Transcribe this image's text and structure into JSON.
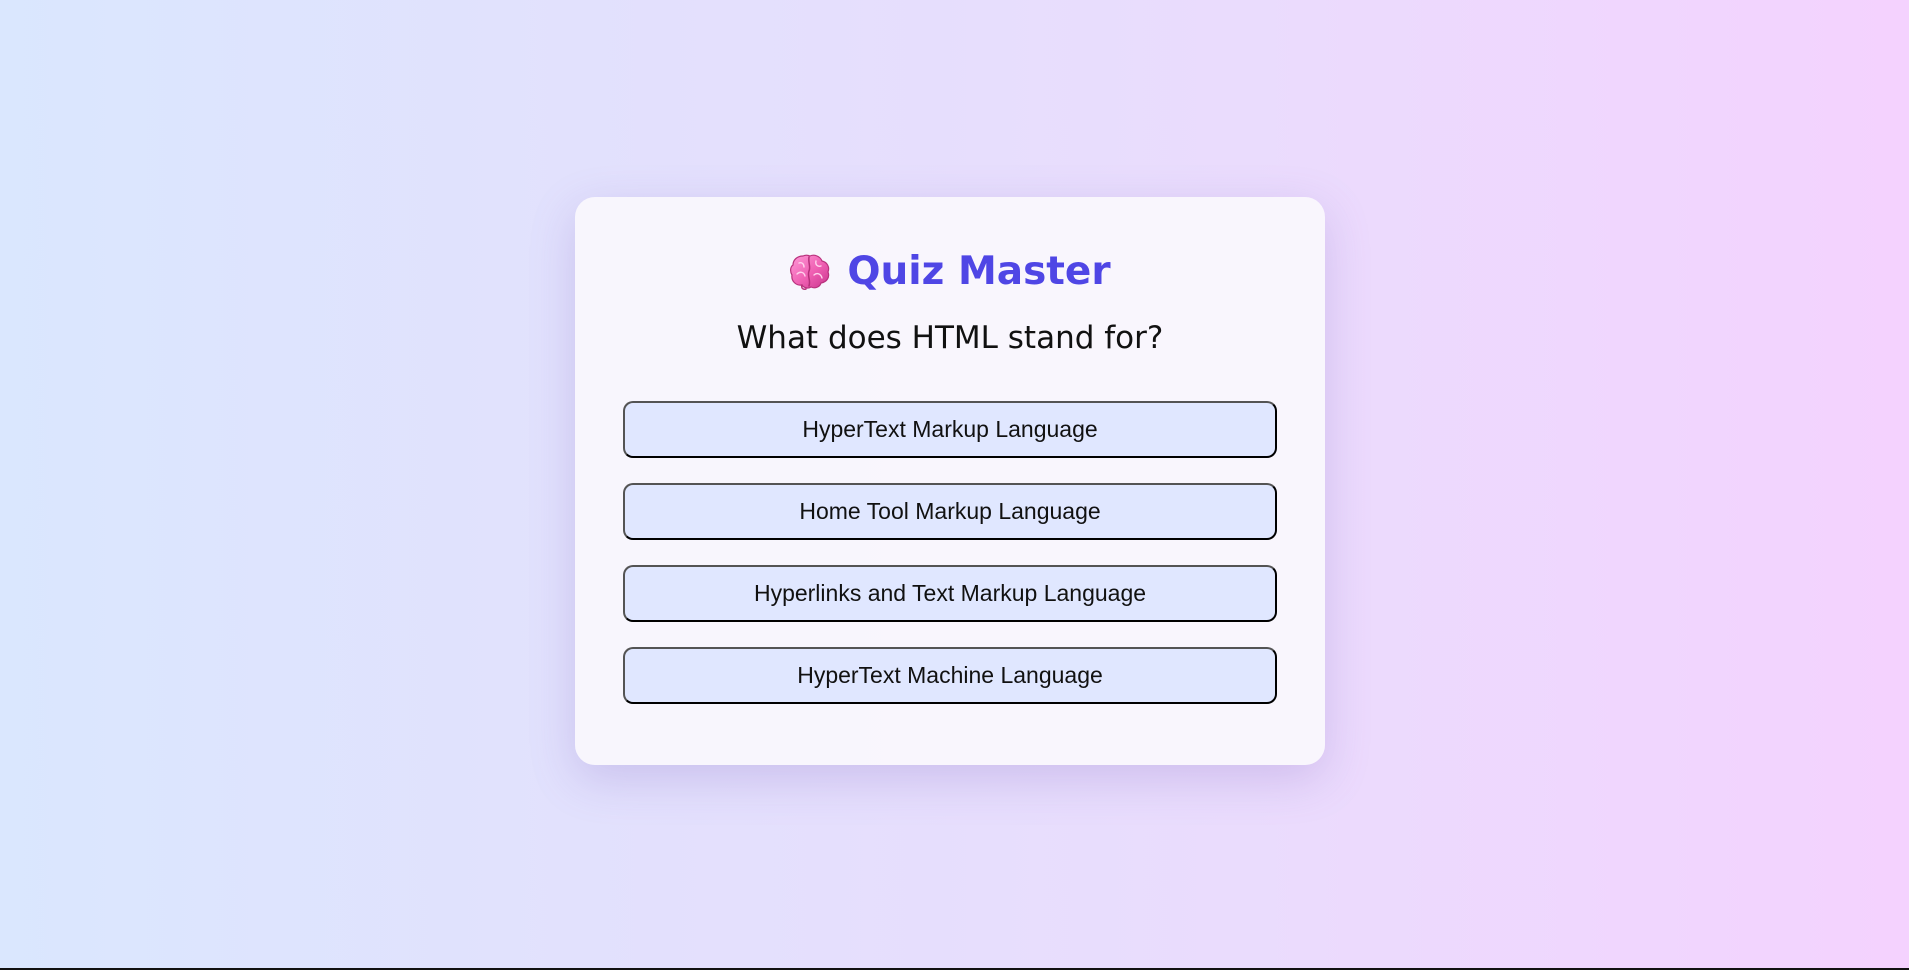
{
  "app": {
    "title": "Quiz Master",
    "logo_icon": "brain-icon",
    "accent_color": "#4f46e5"
  },
  "quiz": {
    "question": "What does HTML stand for?",
    "answers": [
      "HyperText Markup Language",
      "Home Tool Markup Language",
      "Hyperlinks and Text Markup Language",
      "HyperText Machine Language"
    ],
    "answer_background": "#e0e7ff"
  }
}
